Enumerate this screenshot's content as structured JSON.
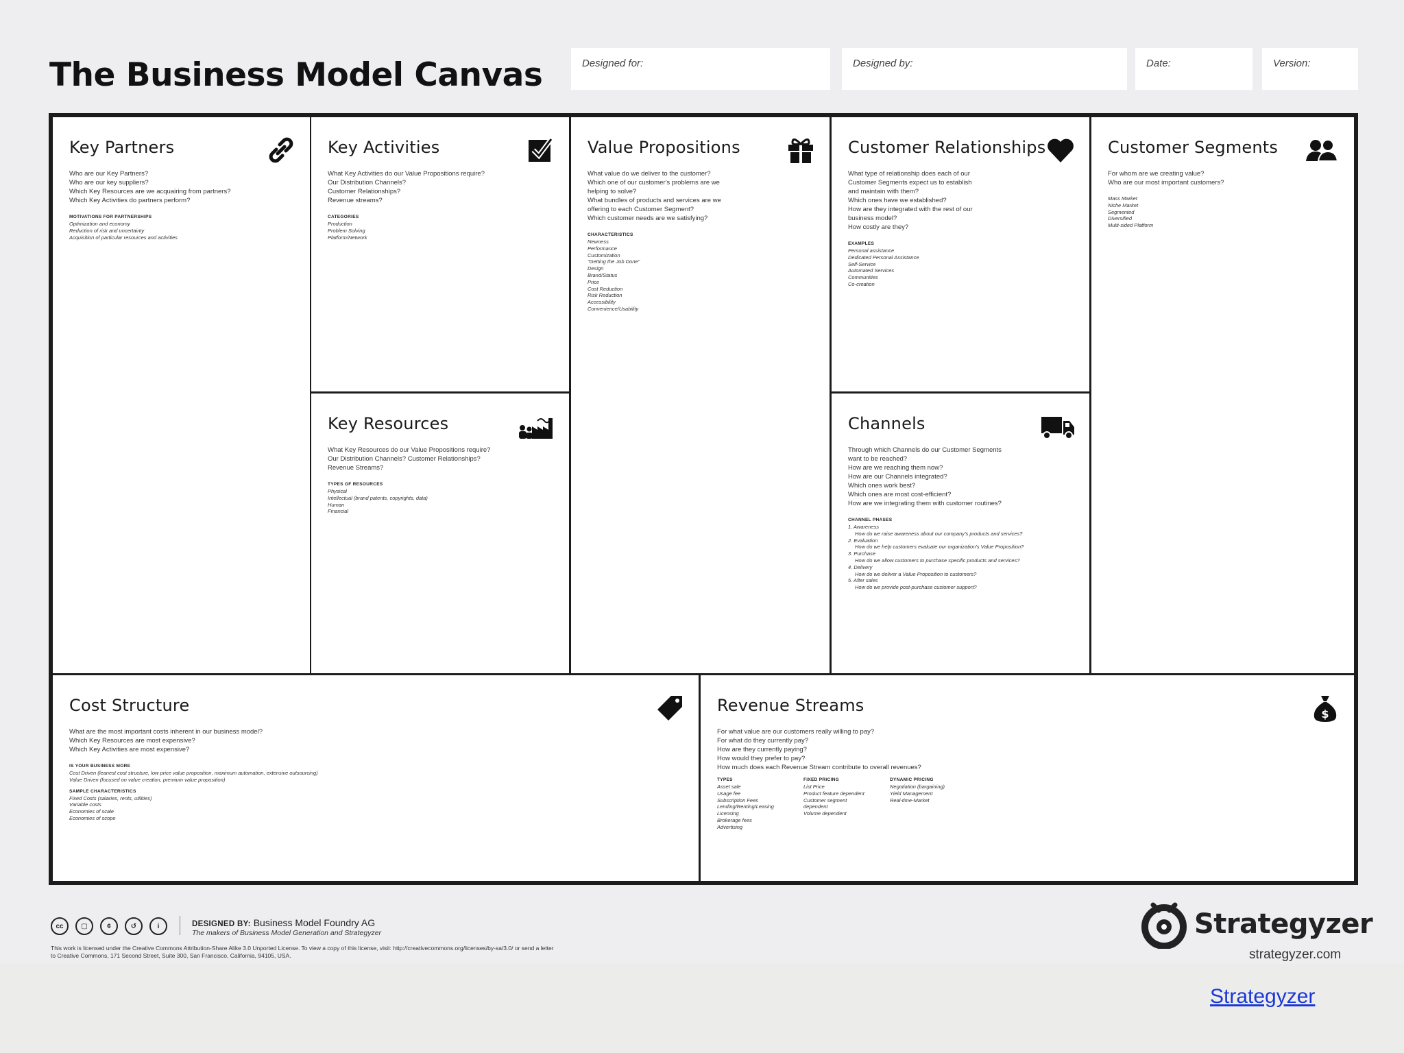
{
  "title": "The Business Model Canvas",
  "meta": {
    "designed_for": "Designed for:",
    "designed_by": "Designed by:",
    "date": "Date:",
    "version": "Version:"
  },
  "blocks": {
    "key_partners": {
      "title": "Key Partners",
      "icon": "link-icon",
      "questions": [
        "Who are our Key Partners?",
        "Who are our key suppliers?",
        "Which Key Resources are we acquairing from partners?",
        "Which Key Activities do partners perform?"
      ],
      "section": "MOTIVATIONS FOR PARTNERSHIPS",
      "items": [
        "Optimization and economy",
        "Reduction of risk and uncertainty",
        "Acquisition of particular resources and activities"
      ]
    },
    "key_activities": {
      "title": "Key Activities",
      "icon": "checkbox-icon",
      "questions": [
        "What Key Activities do our Value Propositions require?",
        "Our Distribution Channels?",
        "Customer Relationships?",
        "Revenue streams?"
      ],
      "section": "CATEGORIES",
      "items": [
        "Production",
        "Problem Solving",
        "Platform/Network"
      ]
    },
    "key_resources": {
      "title": "Key Resources",
      "icon": "factory-icon",
      "questions": [
        "What Key Resources do our Value Propositions require?",
        "Our Distribution Channels? Customer Relationships?",
        "Revenue Streams?"
      ],
      "section": "TYPES OF RESOURCES",
      "items": [
        "Physical",
        "Intellectual (brand patents, copyrights, data)",
        "Human",
        "Financial"
      ]
    },
    "value_propositions": {
      "title": "Value Propositions",
      "icon": "gift-icon",
      "questions": [
        "What value do we deliver to the customer?",
        "Which one of our customer's problems are we",
        "helping to solve?",
        "What bundles of products and services are we",
        "offering to each Customer Segment?",
        "Which customer needs are we satisfying?"
      ],
      "section": "CHARACTERISTICS",
      "items": [
        "Newness",
        "Performance",
        "Customization",
        "\"Getting the Job Done\"",
        "Design",
        "Brand/Status",
        "Price",
        "Cost Reduction",
        "Risk Reduction",
        "Accessibility",
        "Convenience/Usability"
      ]
    },
    "customer_relationships": {
      "title": "Customer Relationships",
      "icon": "heart-icon",
      "questions": [
        "What type of relationship does each of our",
        "Customer Segments expect us to establish",
        "and maintain with them?",
        "Which ones have we established?",
        "How are they integrated with the rest of our",
        "business model?",
        "How costly are they?"
      ],
      "section": "EXAMPLES",
      "items": [
        "Personal assistance",
        "Dedicated Personal Assistance",
        "Self-Service",
        "Automated Services",
        "Communities",
        "Co-creation"
      ]
    },
    "channels": {
      "title": "Channels",
      "icon": "truck-icon",
      "questions": [
        "Through which Channels do our Customer Segments",
        "want to be reached?",
        "How are we reaching them now?",
        "How are our Channels integrated?",
        "Which ones work best?",
        "Which ones are most cost-efficient?",
        "How are we integrating them with customer routines?"
      ],
      "section": "CHANNEL PHASES",
      "phases": [
        {
          "label": "1. Awareness",
          "detail": "How do we raise awareness about our company's products and services?"
        },
        {
          "label": "2. Evaluation",
          "detail": "How do we help customers evaluate our organization's Value Proposition?"
        },
        {
          "label": "3. Purchase",
          "detail": "How do we allow customers to purchase specific products and services?"
        },
        {
          "label": "4. Delivery",
          "detail": "How do we deliver a Value Proposition to customers?"
        },
        {
          "label": "5. After sales",
          "detail": "How do we provide post-purchase customer support?"
        }
      ]
    },
    "customer_segments": {
      "title": "Customer Segments",
      "icon": "people-icon",
      "questions": [
        "For whom are we creating value?",
        "Who are our most important customers?"
      ],
      "items": [
        "Mass Market",
        "Niche Market",
        "Segmented",
        "Diversified",
        "Multi-sided Platform"
      ]
    },
    "cost_structure": {
      "title": "Cost Structure",
      "icon": "tag-icon",
      "questions": [
        "What are the most important costs inherent in our business model?",
        "Which Key Resources are most expensive?",
        "Which Key Activities are most expensive?"
      ],
      "section1": "IS YOUR BUSINESS MORE",
      "items1": [
        "Cost Driven (leanest cost structure, low price value proposition, maximum automation, extensive outsourcing)",
        "Value Driven (focused on value creation, premium value proposition)"
      ],
      "section2": "SAMPLE CHARACTERISTICS",
      "items2": [
        "Fixed Costs (salaries, rents, utilities)",
        "Variable costs",
        "Economies of scale",
        "Economies of scope"
      ]
    },
    "revenue_streams": {
      "title": "Revenue Streams",
      "icon": "money-bag-icon",
      "questions": [
        "For what value are our customers really willing to pay?",
        "For what do they currently pay?",
        "How are they currently paying?",
        "How would they prefer to pay?",
        "How much does each Revenue Stream contribute to overall revenues?"
      ],
      "columns": [
        {
          "header": "TYPES",
          "items": [
            "Asset sale",
            "Usage fee",
            "Subscription Fees",
            "Lending/Renting/Leasing",
            "Licensing",
            "Brokerage fees",
            "Advertising"
          ]
        },
        {
          "header": "FIXED PRICING",
          "items": [
            "List Price",
            "Product feature dependent",
            "Customer segment",
            "dependent",
            "Volume dependent"
          ]
        },
        {
          "header": "DYNAMIC PRICING",
          "items": [
            "Negotiation (bargaining)",
            "Yield Management",
            "Real-time-Market"
          ]
        }
      ]
    }
  },
  "footer": {
    "cc_icons": [
      "cc",
      "by",
      "nc",
      "sa",
      "i"
    ],
    "designed_by_label": "DESIGNED BY:",
    "designed_by_value": "Business Model Foundry AG",
    "makers": "The makers of Business Model Generation and Strategyzer",
    "license": "This work is licensed under the Creative Commons Attribution-Share Alike 3.0 Unported License. To view a copy of this license, visit: http://creativecommons.org/licenses/by-sa/3.0/ or send a letter to Creative Commons, 171 Second Street, Suite 300, San Francisco, California, 94105, USA.",
    "brand_name": "Strategyzer",
    "brand_url": "strategyzer.com"
  },
  "link_text": "Strategyzer",
  "colors": {
    "border": "#1c1c1c",
    "background": "#eeeef0",
    "link": "#1a37d6"
  }
}
